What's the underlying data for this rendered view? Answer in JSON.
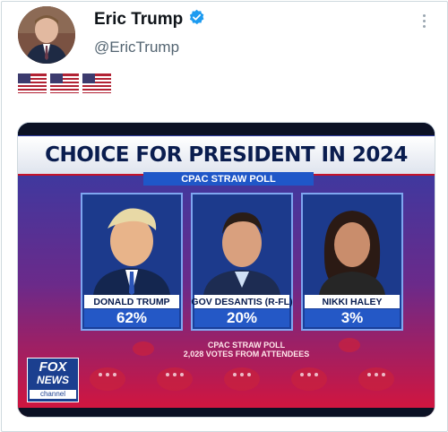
{
  "tweet": {
    "display_name": "Eric Trump",
    "handle": "@EricTrump",
    "verified": true,
    "verified_icon": "verified-badge-icon",
    "more_icon": "more-options-icon",
    "flags": [
      "flag-usa-icon",
      "flag-usa-icon",
      "flag-usa-icon"
    ]
  },
  "broadcast": {
    "headline": "CHOICE FOR PRESIDENT IN 2024",
    "subheadline": "CPAC STRAW POLL",
    "candidates": [
      {
        "name": "DONALD TRUMP",
        "percent": "62%"
      },
      {
        "name": "GOV DESANTIS (R-FL)",
        "percent": "20%"
      },
      {
        "name": "NIKKI HALEY",
        "percent": "3%"
      }
    ],
    "footer_line1": "CPAC STRAW POLL",
    "footer_line2": "2,028 VOTES FROM ATTENDEES",
    "logo_top": "FOX",
    "logo_mid": "NEWS",
    "logo_bottom": "channel"
  },
  "colors": {
    "verified": "#1d9bf0",
    "banner_blue": "#1f57c8",
    "fox_red": "#c6132a"
  }
}
